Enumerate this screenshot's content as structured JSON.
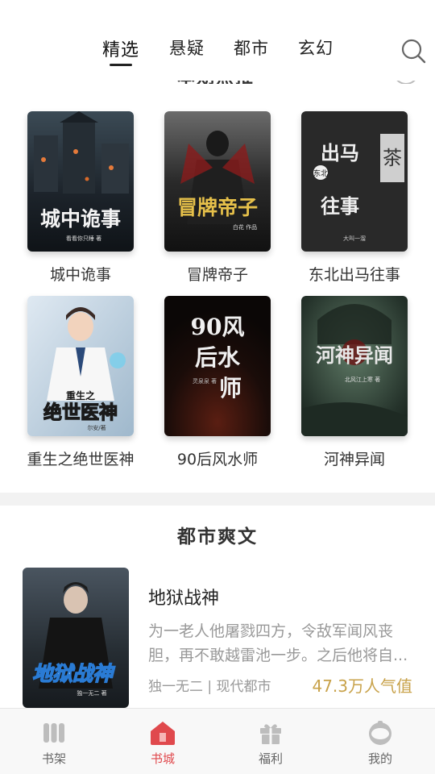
{
  "top_tabs": [
    {
      "label": "精选",
      "active": true
    },
    {
      "label": "悬疑",
      "active": false
    },
    {
      "label": "都市",
      "active": false
    },
    {
      "label": "玄幻",
      "active": false
    }
  ],
  "cut_section": {
    "title": "本期热推"
  },
  "books": [
    {
      "title": "城中诡事",
      "cover_text": "城中诡事",
      "cover_author": "看看你只睡 著"
    },
    {
      "title": "冒牌帝子",
      "cover_text": "冒牌帝子",
      "cover_author": "白花 作品"
    },
    {
      "title": "东北出马往事",
      "cover_text": "出马往事",
      "cover_sub": "东北",
      "cover_side": "茶",
      "cover_author": "大叫一溜"
    },
    {
      "title": "重生之绝世医神",
      "cover_text": "绝世医神",
      "cover_sub": "重生之",
      "cover_author": "尔安/著"
    },
    {
      "title": "90后风水师",
      "cover_text": "90风后水师",
      "cover_author": "灵泉泉 著"
    },
    {
      "title": "河神异闻",
      "cover_text": "河神异闻",
      "cover_author": "北风江上寒 著"
    }
  ],
  "section": {
    "title": "都市爽文"
  },
  "featured": {
    "title": "地狱战神",
    "description": "为一老人他屠戮四方，令敌军闻风丧胆，再不敢越雷池一步。之后他将自...",
    "author_meta": "独一无二 | 现代都市",
    "popularity": "47.3万人气值",
    "cover_text": "地狱战神",
    "cover_author": "独一无二 著"
  },
  "bottom_nav": [
    {
      "label": "书架",
      "icon": "bookshelf-icon",
      "active": false
    },
    {
      "label": "书城",
      "icon": "bookstore-icon",
      "active": true
    },
    {
      "label": "福利",
      "icon": "gift-icon",
      "active": false
    },
    {
      "label": "我的",
      "icon": "profile-icon",
      "active": false
    }
  ],
  "colors": {
    "accent": "#e0494d",
    "popularity": "#c8a24a",
    "divider": "#f2f2f2"
  }
}
